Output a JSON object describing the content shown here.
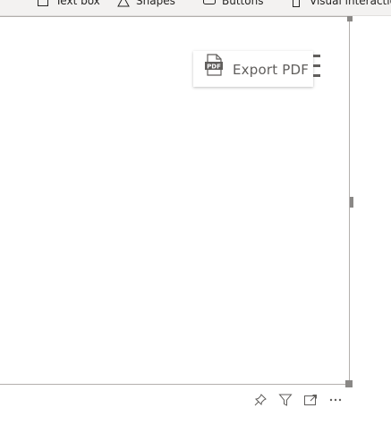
{
  "ribbon": {
    "items": [
      {
        "label": "Text box",
        "icon": "text-box-icon"
      },
      {
        "label": "Shapes",
        "icon": "shapes-icon"
      },
      {
        "label": "Buttons",
        "icon": "buttons-icon"
      },
      {
        "label": "Visual interactions",
        "icon": "visual-interactions-icon"
      }
    ]
  },
  "visual": {
    "export_label": "Export PDF",
    "export_icon": "pdf-file-icon",
    "header_icons": [
      "pin-icon",
      "filter-icon",
      "focus-mode-icon",
      "more-options-icon"
    ]
  },
  "colors": {
    "ribbon_bg": "#f3f2f1",
    "frame_border": "#b3b0ad",
    "label_text": "#605e5c"
  }
}
